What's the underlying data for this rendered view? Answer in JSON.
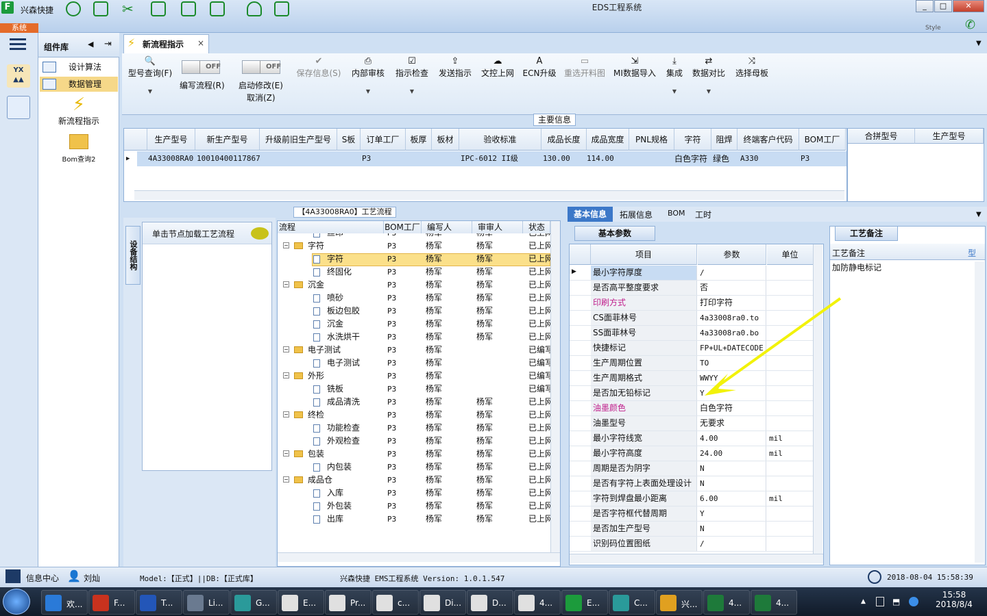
{
  "titlebar": {
    "app_name": "兴森快捷",
    "window_title": "EDS工程系统",
    "min": "_",
    "max": "□",
    "close": "✕",
    "sys_tab": "系统",
    "style_label": "Style"
  },
  "component_panel": {
    "title": "组件库",
    "items": [
      "设计算法",
      "数据管理"
    ],
    "big_items": [
      "新流程指示",
      "Bom查询2"
    ]
  },
  "main_tab": {
    "label": "新流程指示",
    "close": "×"
  },
  "toolbar": {
    "query": "型号查询(F)",
    "edit_flow_toggle": "OFF",
    "edit_flow": "编写流程(R)",
    "start_modify_toggle": "OFF",
    "start_modify": "启动修改(E)",
    "cancel": "取消(Z)",
    "save": "保存信息(S)",
    "internal_review": "内部审核",
    "check": "指示检查",
    "send": "发送指示",
    "upload": "文控上网",
    "ecn": "ECN升级",
    "reselect": "重选开料图",
    "mi_import": "MI数据导入",
    "integrate": "集成",
    "compare": "数据对比",
    "select_board": "选择母板"
  },
  "main_info": {
    "label": "主要信息",
    "columns": [
      "生产型号",
      "新生产型号",
      "升级前旧生产型号",
      "S板",
      "订单工厂",
      "板厚",
      "板材",
      "验收标准",
      "成品长度",
      "成品宽度",
      "PNL规格",
      "字符",
      "阻焊",
      "终端客户代码",
      "BOM工厂"
    ],
    "row": [
      "4A33008RA0",
      "10010400117867",
      "",
      "",
      "P3",
      "",
      "",
      "IPC-6012 II级",
      "130.00",
      "114.00",
      "",
      "白色字符",
      "绿色",
      "A330",
      "P3"
    ],
    "side_columns": [
      "合拼型号",
      "生产型号"
    ]
  },
  "process_tree": {
    "title": "【4A33008RA0】工艺流程",
    "vertical_tab": "设备结构",
    "left_hint": "单击节点加载工艺流程",
    "columns": [
      "流程",
      "BOM工厂",
      "编写人",
      "审审人",
      "状态"
    ],
    "rows": [
      {
        "name": "丝印",
        "level": 1,
        "folder": false,
        "factory": "P3",
        "author": "杨军",
        "reviewer": "杨军",
        "status": "已上网"
      },
      {
        "name": "字符",
        "level": 0,
        "folder": true,
        "factory": "P3",
        "author": "杨军",
        "reviewer": "杨军",
        "status": "已上网"
      },
      {
        "name": "字符",
        "level": 1,
        "folder": false,
        "factory": "P3",
        "author": "杨军",
        "reviewer": "杨军",
        "status": "已上网"
      },
      {
        "name": "终固化",
        "level": 1,
        "folder": false,
        "factory": "P3",
        "author": "杨军",
        "reviewer": "杨军",
        "status": "已上网"
      },
      {
        "name": "沉金",
        "level": 0,
        "folder": true,
        "factory": "P3",
        "author": "杨军",
        "reviewer": "杨军",
        "status": "已上网"
      },
      {
        "name": "喷砂",
        "level": 1,
        "folder": false,
        "factory": "P3",
        "author": "杨军",
        "reviewer": "杨军",
        "status": "已上网"
      },
      {
        "name": "板边包胶",
        "level": 1,
        "folder": false,
        "factory": "P3",
        "author": "杨军",
        "reviewer": "杨军",
        "status": "已上网"
      },
      {
        "name": "沉金",
        "level": 1,
        "folder": false,
        "factory": "P3",
        "author": "杨军",
        "reviewer": "杨军",
        "status": "已上网"
      },
      {
        "name": "水洗烘干",
        "level": 1,
        "folder": false,
        "factory": "P3",
        "author": "杨军",
        "reviewer": "杨军",
        "status": "已上网"
      },
      {
        "name": "电子测试",
        "level": 0,
        "folder": true,
        "factory": "P3",
        "author": "杨军",
        "reviewer": "",
        "status": "已编写"
      },
      {
        "name": "电子测试",
        "level": 1,
        "folder": false,
        "factory": "P3",
        "author": "杨军",
        "reviewer": "",
        "status": "已编写"
      },
      {
        "name": "外形",
        "level": 0,
        "folder": true,
        "factory": "P3",
        "author": "杨军",
        "reviewer": "",
        "status": "已编写"
      },
      {
        "name": "铣板",
        "level": 1,
        "folder": false,
        "factory": "P3",
        "author": "杨军",
        "reviewer": "",
        "status": "已编写"
      },
      {
        "name": "成品清洗",
        "level": 1,
        "folder": false,
        "factory": "P3",
        "author": "杨军",
        "reviewer": "杨军",
        "status": "已上网"
      },
      {
        "name": "终检",
        "level": 0,
        "folder": true,
        "factory": "P3",
        "author": "杨军",
        "reviewer": "杨军",
        "status": "已上网"
      },
      {
        "name": "功能检查",
        "level": 1,
        "folder": false,
        "factory": "P3",
        "author": "杨军",
        "reviewer": "杨军",
        "status": "已上网"
      },
      {
        "name": "外观检查",
        "level": 1,
        "folder": false,
        "factory": "P3",
        "author": "杨军",
        "reviewer": "杨军",
        "status": "已上网"
      },
      {
        "name": "包装",
        "level": 0,
        "folder": true,
        "factory": "P3",
        "author": "杨军",
        "reviewer": "杨军",
        "status": "已上网"
      },
      {
        "name": "内包装",
        "level": 1,
        "folder": false,
        "factory": "P3",
        "author": "杨军",
        "reviewer": "杨军",
        "status": "已上网"
      },
      {
        "name": "成品仓",
        "level": 0,
        "folder": true,
        "factory": "P3",
        "author": "杨军",
        "reviewer": "杨军",
        "status": "已上网"
      },
      {
        "name": "入库",
        "level": 1,
        "folder": false,
        "factory": "P3",
        "author": "杨军",
        "reviewer": "杨军",
        "status": "已上网"
      },
      {
        "name": "外包装",
        "level": 1,
        "folder": false,
        "factory": "P3",
        "author": "杨军",
        "reviewer": "杨军",
        "status": "已上网"
      },
      {
        "name": "出库",
        "level": 1,
        "folder": false,
        "factory": "P3",
        "author": "杨军",
        "reviewer": "杨军",
        "status": "已上网"
      }
    ]
  },
  "right_tabs": [
    "基本信息",
    "拓展信息",
    "BOM",
    "工时"
  ],
  "basic_params": {
    "title": "基本参数",
    "columns": [
      "项目",
      "参数",
      "单位"
    ],
    "rows": [
      {
        "k": "最小字符厚度",
        "v": "/",
        "u": "",
        "hl": false
      },
      {
        "k": "是否高平整度要求",
        "v": "否",
        "u": "",
        "hl": false
      },
      {
        "k": "印刷方式",
        "v": "打印字符",
        "u": "",
        "hl": true
      },
      {
        "k": "CS面菲林号",
        "v": "4a33008ra0.to",
        "u": "",
        "hl": false
      },
      {
        "k": "SS面菲林号",
        "v": "4a33008ra0.bo",
        "u": "",
        "hl": false
      },
      {
        "k": "快捷标记",
        "v": "FP+UL+DATECODE",
        "u": "",
        "hl": false
      },
      {
        "k": "生产周期位置",
        "v": "TO",
        "u": "",
        "hl": false
      },
      {
        "k": "生产周期格式",
        "v": "WWYY",
        "u": "",
        "hl": false
      },
      {
        "k": "是否加无铅标记",
        "v": "Y",
        "u": "",
        "hl": false
      },
      {
        "k": "油墨颜色",
        "v": "白色字符",
        "u": "",
        "hl": true
      },
      {
        "k": "油墨型号",
        "v": "无要求",
        "u": "",
        "hl": false
      },
      {
        "k": "最小字符线宽",
        "v": "4.00",
        "u": "mil",
        "hl": false
      },
      {
        "k": "最小字符高度",
        "v": "24.00",
        "u": "mil",
        "hl": false
      },
      {
        "k": "周期是否为阴字",
        "v": "N",
        "u": "",
        "hl": false
      },
      {
        "k": "是否有字符上表面处理设计",
        "v": "N",
        "u": "",
        "hl": false
      },
      {
        "k": "字符到焊盘最小距离",
        "v": "6.00",
        "u": "mil",
        "hl": false
      },
      {
        "k": "是否字符框代替周期",
        "v": "Y",
        "u": "",
        "hl": false
      },
      {
        "k": "是否加生产型号",
        "v": "N",
        "u": "",
        "hl": false
      },
      {
        "k": "识别码位置图纸",
        "v": "/",
        "u": "",
        "hl": false
      }
    ]
  },
  "process_notes": {
    "title": "工艺备注",
    "col1": "工艺备注",
    "col2": "型",
    "note": "加防静电标记"
  },
  "status_bar": {
    "info_center": "信息中心",
    "user": "刘灿",
    "model": "Model:【正式】||DB:【正式库】",
    "system": "兴森快捷 EMS工程系统 Version: 1.0.1.547",
    "datetime": "2018-08-04 15:58:39"
  },
  "taskbar": {
    "items": [
      "欢...",
      "F...",
      "T...",
      "Li...",
      "G...",
      "E...",
      "Pr...",
      "c...",
      "Di...",
      "D...",
      "4...",
      "E...",
      "C...",
      "兴...",
      "4...",
      "4..."
    ],
    "time": "15:58",
    "date": "2018/8/4"
  },
  "colors": {
    "accent": "#3c78c8",
    "selection": "#c8dcf3",
    "tree_selection": "#fbe08a",
    "arrow": "#f2f20a",
    "magenta_label": "#c0208c"
  }
}
